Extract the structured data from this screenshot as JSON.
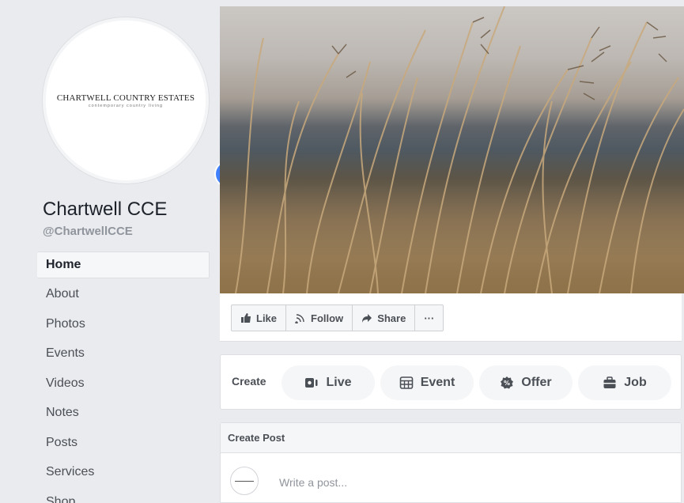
{
  "page": {
    "logo_title": "CHARTWELL COUNTRY ESTATES",
    "logo_subtitle": "contemporary country living",
    "name": "Chartwell CCE",
    "handle": "@ChartwellCCE"
  },
  "nav": {
    "items": [
      {
        "label": "Home",
        "active": true
      },
      {
        "label": "About"
      },
      {
        "label": "Photos"
      },
      {
        "label": "Events"
      },
      {
        "label": "Videos"
      },
      {
        "label": "Notes"
      },
      {
        "label": "Posts"
      },
      {
        "label": "Services"
      },
      {
        "label": "Shop"
      }
    ]
  },
  "actions": {
    "like": "Like",
    "follow": "Follow",
    "share": "Share",
    "more": "···"
  },
  "create": {
    "label": "Create",
    "live": "Live",
    "event": "Event",
    "offer": "Offer",
    "job": "Job"
  },
  "post": {
    "header": "Create Post",
    "placeholder": "Write a post..."
  },
  "colors": {
    "accent": "#4080ff",
    "background": "#e9ebee",
    "text_secondary": "#4b4f56"
  }
}
